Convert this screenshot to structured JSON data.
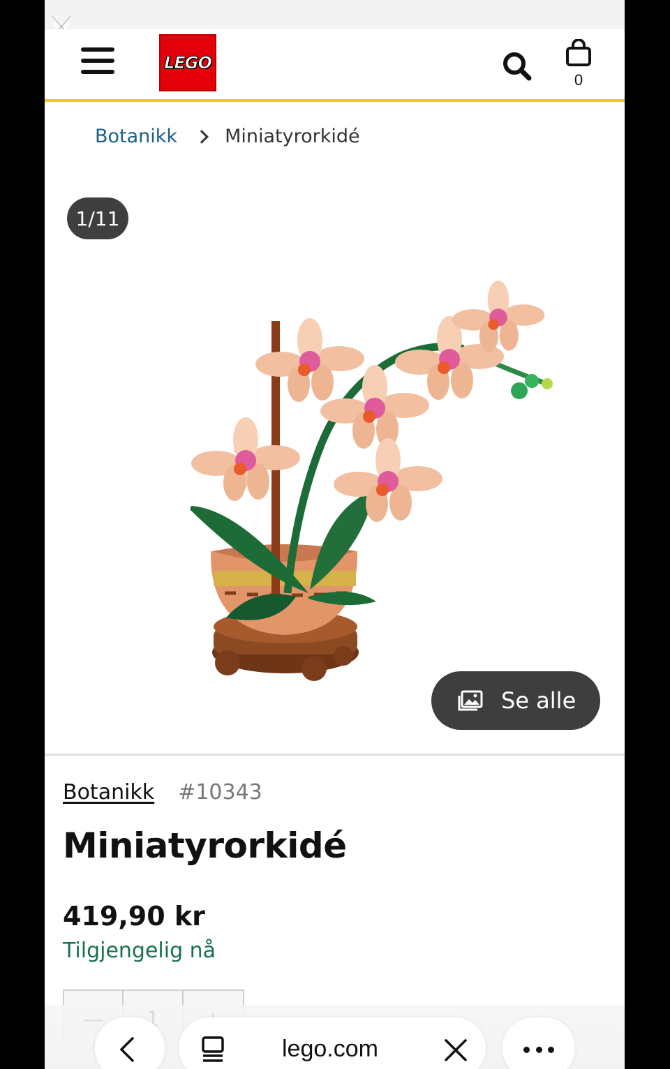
{
  "header": {
    "logo_text": "LEGO",
    "cart_count": "0",
    "accent_color": "#f5c81a",
    "logo_color": "#e3000b"
  },
  "breadcrumb": {
    "parent": "Botanikk",
    "current": "Miniatyrorkidé"
  },
  "gallery": {
    "counter": "1/11",
    "see_all_label": "Se alle"
  },
  "product": {
    "theme": "Botanikk",
    "item_number": "#10343",
    "title": "Miniatyrorkidé",
    "price": "419,90 kr",
    "availability": "Tilgjengelig nå",
    "availability_color": "#15724b"
  },
  "quantity": {
    "minus": "—",
    "value": "1",
    "plus": "+"
  },
  "browser": {
    "url": "lego.com"
  },
  "icons": [
    "close-icon",
    "menu-icon",
    "search-icon",
    "shopping-bag-icon",
    "chevron-right-icon",
    "gallery-icon",
    "back-icon",
    "tabs-icon",
    "more-icon"
  ]
}
